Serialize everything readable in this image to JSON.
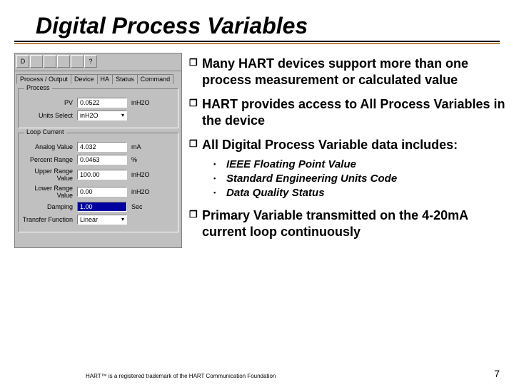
{
  "title": "Digital Process Variables",
  "panel": {
    "toolbar": [
      "D",
      "",
      "",
      "",
      "",
      "?"
    ],
    "tabs": [
      "Process / Output",
      "Device",
      "HA",
      "Status",
      "Command"
    ],
    "group_process_label": "Process",
    "pv_label": "PV",
    "pv_value": "0.0522",
    "pv_unit": "inH2O",
    "units_label": "Units Select",
    "units_value": "inH2O",
    "group_loop_label": "Loop Current",
    "rows": [
      {
        "lbl": "Analog Value",
        "val": "4.032",
        "unit": "mA"
      },
      {
        "lbl": "Percent Range",
        "val": "0.0463",
        "unit": "%"
      },
      {
        "lbl": "Upper Range Value",
        "val": "100.00",
        "unit": "inH2O"
      },
      {
        "lbl": "Lower Range Value",
        "val": "0.00",
        "unit": "inH2O"
      },
      {
        "lbl": "Damping",
        "val": "1.00",
        "unit": "Sec",
        "blue": true
      },
      {
        "lbl": "Transfer Function",
        "val": "Linear",
        "unit": "",
        "combo": true
      }
    ]
  },
  "bullets": {
    "b1": "Many HART devices support more than one process measurement or calculated value",
    "b2": "HART provides access to All Process Variables in the device",
    "b3": "All Digital Process Variable data includes:",
    "s1": "IEEE Floating Point Value",
    "s2": "Standard Engineering Units Code",
    "s3": "Data Quality Status",
    "b4": "Primary Variable transmitted on the 4-20mA current loop continuously"
  },
  "footer_text": "HART™ is a registered trademark of the HART Communication Foundation",
  "page_number": "7"
}
